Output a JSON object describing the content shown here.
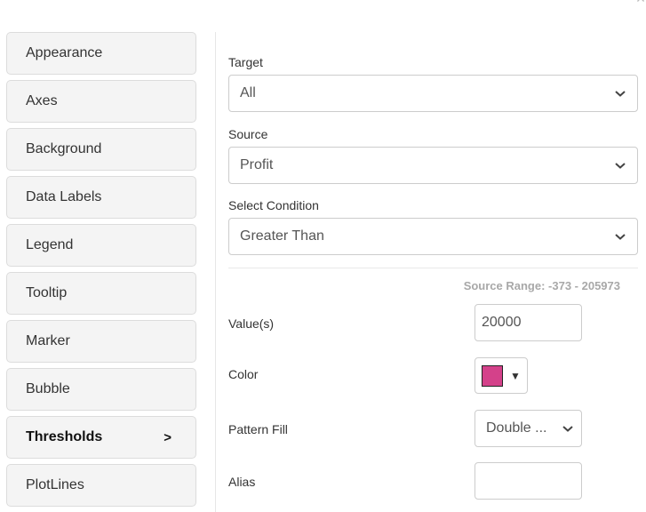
{
  "dialog": {
    "close_icon": "×"
  },
  "sidebar": {
    "items": [
      {
        "label": "Appearance",
        "active": false
      },
      {
        "label": "Axes",
        "active": false
      },
      {
        "label": "Background",
        "active": false
      },
      {
        "label": "Data Labels",
        "active": false
      },
      {
        "label": "Legend",
        "active": false
      },
      {
        "label": "Tooltip",
        "active": false
      },
      {
        "label": "Marker",
        "active": false
      },
      {
        "label": "Bubble",
        "active": false
      },
      {
        "label": "Thresholds",
        "active": true,
        "indicator": ">"
      },
      {
        "label": "PlotLines",
        "active": false
      }
    ]
  },
  "thresholds": {
    "target": {
      "label": "Target",
      "value": "All"
    },
    "source": {
      "label": "Source",
      "value": "Profit"
    },
    "condition": {
      "label": "Select Condition",
      "value": "Greater Than"
    },
    "source_range": "Source Range: -373 - 205973",
    "values": {
      "label": "Value(s)",
      "value": "20000"
    },
    "color": {
      "label": "Color",
      "value": "#d4418a",
      "caret": "▼"
    },
    "pattern_fill": {
      "label": "Pattern Fill",
      "value": "Double ..."
    },
    "alias": {
      "label": "Alias",
      "value": ""
    }
  }
}
